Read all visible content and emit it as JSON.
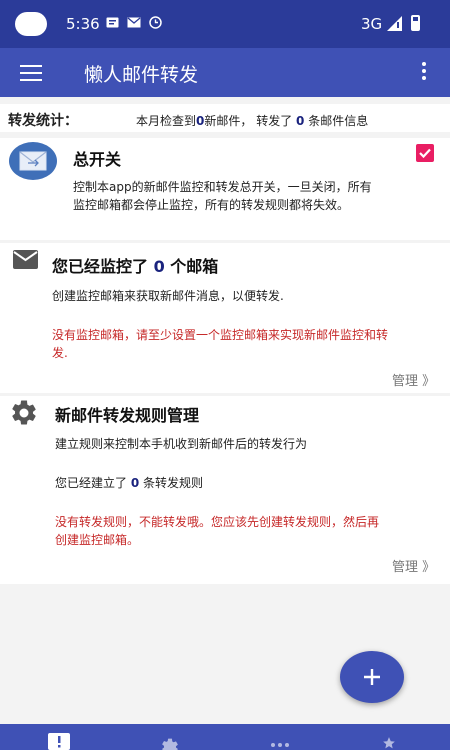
{
  "status_bar": {
    "time": "5:36",
    "network": "3G"
  },
  "app_bar": {
    "title": "懒人邮件转发"
  },
  "stats": {
    "label": "转发统计：",
    "prefix": "本月检查到",
    "checked_count": "0",
    "middle": "新邮件， 转发了 ",
    "forwarded_count": "0",
    "suffix": " 条邮件信息"
  },
  "master_switch": {
    "title": "总开关",
    "description": "控制本app的新邮件监控和转发总开关，一旦关闭，所有监控邮箱都会停止监控，所有的转发规则都将失效。",
    "checked": true
  },
  "mailbox_card": {
    "title_prefix": "您已经监控了 ",
    "count": "0",
    "title_suffix": " 个邮箱",
    "description": "创建监控邮箱来获取新邮件消息，以便转发.",
    "warning": "没有监控邮箱，请至少设置一个监控邮箱来实现新邮件监控和转发.",
    "manage_label": "管理 》"
  },
  "rules_card": {
    "title": "新邮件转发规则管理",
    "description": "建立规则来控制本手机收到新邮件后的转发行为",
    "count_prefix": "您已经建立了 ",
    "count": "0",
    "count_suffix": " 条转发规则",
    "warning": "没有转发规则，不能转发哦。您应该先创建转发规则，然后再创建监控邮箱。",
    "manage_label": "管理 》"
  },
  "colors": {
    "status_bar": "#2b3b99",
    "primary": "#3f51b5",
    "accent": "#e91e63",
    "warning_text": "#c62828",
    "count_text": "#1a237e"
  },
  "icons": {
    "menu": "hamburger-icon",
    "more": "more-vert-icon",
    "envelope": "envelope-icon",
    "mail": "mail-icon",
    "gear": "gear-icon",
    "add": "add-icon"
  }
}
